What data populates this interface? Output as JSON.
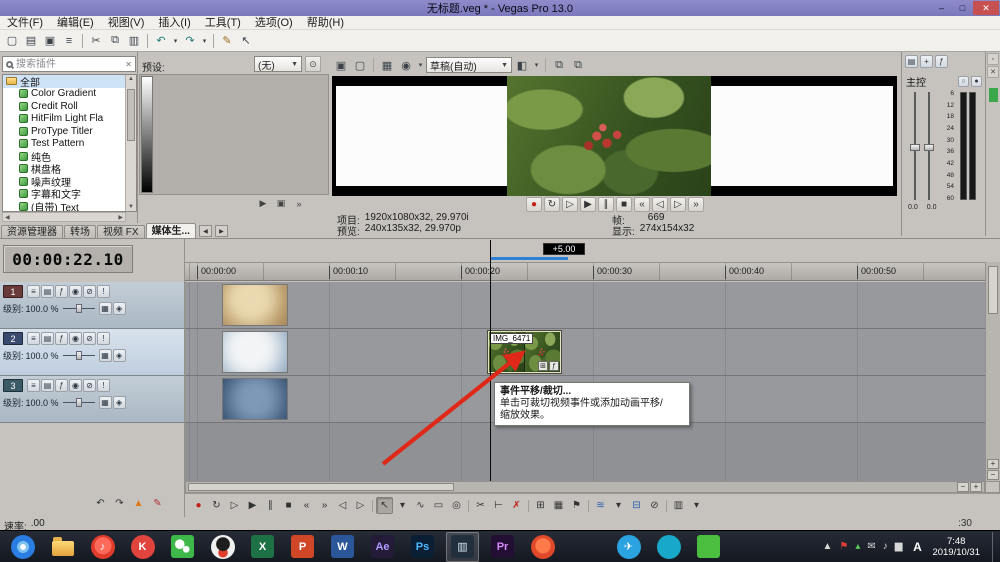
{
  "titlebar": {
    "title": "无标题.veg * - Vegas Pro 13.0",
    "buttons": [
      {
        "name": "minimize-button",
        "glyph": "–"
      },
      {
        "name": "maximize-button",
        "glyph": "□"
      },
      {
        "name": "close-button",
        "glyph": "✕",
        "cls": "close"
      }
    ]
  },
  "menubar": {
    "items": [
      {
        "label": "文件(F)"
      },
      {
        "label": "编辑(E)"
      },
      {
        "label": "视图(V)"
      },
      {
        "label": "插入(I)"
      },
      {
        "label": "工具(T)"
      },
      {
        "label": "选项(O)"
      },
      {
        "label": "帮助(H)"
      }
    ]
  },
  "toolbar": {
    "buttons": [
      {
        "name": "new-project-icon",
        "glyph": "▢"
      },
      {
        "name": "open-project-icon",
        "glyph": "▤"
      },
      {
        "name": "save-project-icon",
        "glyph": "▣"
      },
      {
        "name": "project-properties-icon",
        "glyph": "≡"
      },
      {
        "name": "separator",
        "glyph": "",
        "cls": "sep",
        "inter": "false"
      },
      {
        "name": "cut-icon",
        "glyph": "✂"
      },
      {
        "name": "copy-icon",
        "glyph": "⧉"
      },
      {
        "name": "paste-icon",
        "glyph": "▥"
      },
      {
        "name": "separator",
        "glyph": "",
        "cls": "sep",
        "inter": "false"
      },
      {
        "name": "undo-icon",
        "glyph": "↶",
        "color": "#1f7a7a"
      },
      {
        "name": "undo-caret-icon",
        "glyph": "▾",
        "cls": "caret"
      },
      {
        "name": "redo-icon",
        "glyph": "↷",
        "color": "#1f7a7a"
      },
      {
        "name": "redo-caret-icon",
        "glyph": "▾",
        "cls": "caret"
      },
      {
        "name": "separator",
        "glyph": "",
        "cls": "sep",
        "inter": "false"
      },
      {
        "name": "interactive-tutorials-icon",
        "glyph": "✎",
        "color": "#9a6a20"
      },
      {
        "name": "whats-this-help-icon",
        "glyph": "↖"
      }
    ]
  },
  "generators": {
    "search_placeholder": "搜索插件",
    "items": [
      {
        "label": "全部",
        "icon": "folder",
        "cls": "selected root"
      },
      {
        "label": "Color Gradient",
        "icon": "plugin"
      },
      {
        "label": "Credit Roll",
        "icon": "plugin"
      },
      {
        "label": "HitFilm Light Fla",
        "icon": "plugin"
      },
      {
        "label": "ProType Titler",
        "icon": "plugin"
      },
      {
        "label": "Test Pattern",
        "icon": "plugin"
      },
      {
        "label": "纯色",
        "icon": "plugin"
      },
      {
        "label": "棋盘格",
        "icon": "plugin"
      },
      {
        "label": "噪声纹理",
        "icon": "plugin"
      },
      {
        "label": "字幕和文字",
        "icon": "plugin"
      },
      {
        "label": "(自带) Text",
        "icon": "plugin"
      }
    ],
    "tabs": [
      {
        "label": "资源管理器"
      },
      {
        "label": "转场"
      },
      {
        "label": "视频 FX"
      },
      {
        "label": "媒体生...",
        "cls": "active"
      }
    ]
  },
  "presets": {
    "label": "预设:",
    "dropdown_value": "(无)",
    "buttons": [
      {
        "name": "play-preset-icon",
        "glyph": "▶"
      },
      {
        "name": "stop-preset-icon",
        "glyph": "▣"
      },
      {
        "name": "more-presets-icon",
        "glyph": "»"
      }
    ]
  },
  "preview": {
    "toolbar_left": [
      {
        "name": "project-video-properties-icon",
        "glyph": "▣"
      },
      {
        "name": "external-monitor-icon",
        "glyph": "▢"
      },
      {
        "name": "separator",
        "glyph": "",
        "cls": "sep",
        "inter": "false"
      },
      {
        "name": "video-output-fx-icon",
        "glyph": "▦"
      },
      {
        "name": "overlay-icon",
        "glyph": "◉"
      },
      {
        "name": "overlay-caret-icon",
        "glyph": "▾",
        "cls": "caret"
      }
    ],
    "quality_value": "草稿(自动)",
    "toolbar_right": [
      {
        "name": "split-screen-view-icon",
        "glyph": "◧"
      },
      {
        "name": "split-screen-caret-icon",
        "glyph": "▾",
        "cls": "caret"
      },
      {
        "name": "separator",
        "glyph": "",
        "cls": "sep",
        "inter": "false"
      },
      {
        "name": "grab-snapshot-icon",
        "glyph": "⧉"
      },
      {
        "name": "copy-snapshot-icon",
        "glyph": "⧉"
      }
    ],
    "transport": [
      {
        "name": "record-icon",
        "glyph": "●",
        "color": "#c22018"
      },
      {
        "name": "loop-playback-icon",
        "glyph": "↻"
      },
      {
        "name": "play-from-start-icon",
        "glyph": "▷"
      },
      {
        "name": "play-icon",
        "glyph": "▶"
      },
      {
        "name": "pause-icon",
        "glyph": "∥"
      },
      {
        "name": "stop-icon",
        "glyph": "■"
      },
      {
        "name": "go-to-start-icon",
        "glyph": "«"
      },
      {
        "name": "previous-frame-icon",
        "glyph": "◁"
      },
      {
        "name": "next-frame-icon",
        "glyph": "▷"
      },
      {
        "name": "go-to-end-icon",
        "glyph": "»"
      }
    ],
    "info": {
      "project_label": "项目:",
      "project_value": "1920x1080x32, 29.970i",
      "frame_label": "帧:",
      "frame_value": "669",
      "preview_label": "预览:",
      "preview_value": "240x135x32, 29.970p",
      "display_label": "显示:",
      "display_value": "274x154x32"
    }
  },
  "mixer": {
    "title": "主控",
    "toolbar": [
      {
        "name": "mixer-properties-icon",
        "glyph": "▤"
      },
      {
        "name": "insert-bus-icon",
        "glyph": "+"
      },
      {
        "name": "insert-fx-icon",
        "glyph": "ƒ"
      }
    ],
    "header_icons": [
      {
        "name": "master-mute-icon",
        "glyph": "○"
      },
      {
        "name": "master-solo-icon",
        "glyph": "●"
      }
    ],
    "scale": [
      "6",
      "12",
      "18",
      "24",
      "30",
      "36",
      "42",
      "48",
      "54",
      "60"
    ],
    "fader_values": [
      "0.0",
      "0.0"
    ]
  },
  "right_strip": {
    "icons": [
      {
        "name": "auto-hide-panel-icon",
        "glyph": "▫"
      },
      {
        "name": "close-panel-icon",
        "glyph": "✕"
      }
    ]
  },
  "timeline": {
    "timecode": "00:00:22.10",
    "offset_badge": "+5.00",
    "ruler": [
      {
        "label": "00:00:00"
      },
      {
        "label": "00:00:10"
      },
      {
        "label": "00:00:20"
      },
      {
        "label": "00:00:30"
      },
      {
        "label": "00:00:40"
      },
      {
        "label": "00:00:50"
      }
    ],
    "tracks": [
      {
        "number": "1",
        "color": "#6a3a3a",
        "level_label": "级别:",
        "level_value": "100.0 %"
      },
      {
        "number": "2",
        "color": "#3a4a6e",
        "level_label": "级别:",
        "level_value": "100.0 %"
      },
      {
        "number": "3",
        "color": "#3a5a66",
        "level_label": "级别:",
        "level_value": "100.0 %"
      }
    ],
    "track_icons": [
      {
        "name": "track-motion-icon",
        "glyph": "≡"
      },
      {
        "name": "bypass-fx-icon",
        "glyph": "▤"
      },
      {
        "name": "track-fx-icon",
        "glyph": "ƒ"
      },
      {
        "name": "automation-settings-icon",
        "glyph": "◉"
      },
      {
        "name": "mute-icon",
        "glyph": "⊘"
      },
      {
        "name": "solo-icon",
        "glyph": "!"
      }
    ],
    "level_icons": [
      {
        "name": "compositing-mode-icon",
        "glyph": "▦"
      },
      {
        "name": "make-child-icon",
        "glyph": "◈"
      }
    ],
    "clip": {
      "label": "IMG_6471",
      "icons": [
        {
          "name": "pan-crop-icon",
          "glyph": "⊞"
        },
        {
          "name": "event-fx-icon",
          "glyph": "ƒ"
        }
      ]
    },
    "left_tools": [
      {
        "name": "undo-small-icon",
        "glyph": "↶"
      },
      {
        "name": "redo-small-icon",
        "glyph": "↷"
      },
      {
        "name": "warning-icon",
        "glyph": "▲",
        "color": "#e07818"
      },
      {
        "name": "edit-pen-icon",
        "glyph": "✎",
        "color": "#b03030"
      }
    ],
    "transport": [
      {
        "name": "record-icon",
        "glyph": "●",
        "color": "#c22018"
      },
      {
        "name": "loop-playback-icon",
        "glyph": "↻"
      },
      {
        "name": "play-from-start-icon",
        "glyph": "▷"
      },
      {
        "name": "play-icon",
        "glyph": "▶"
      },
      {
        "name": "pause-icon",
        "glyph": "∥"
      },
      {
        "name": "stop-icon",
        "glyph": "■"
      },
      {
        "name": "go-to-start-icon",
        "glyph": "«"
      },
      {
        "name": "go-to-end-icon",
        "glyph": "»"
      },
      {
        "name": "previous-frame-icon",
        "glyph": "◁"
      },
      {
        "name": "next-frame-icon",
        "glyph": "▷"
      },
      {
        "name": "separator",
        "glyph": "",
        "cls": "sep",
        "inter": "false"
      },
      {
        "name": "normal-edit-tool-icon",
        "glyph": "↖",
        "cls": "active"
      },
      {
        "name": "edit-tool-caret-icon",
        "glyph": "▾",
        "cls": "caret"
      },
      {
        "name": "envelope-edit-tool-icon",
        "glyph": "∿"
      },
      {
        "name": "selection-edit-tool-icon",
        "glyph": "▭"
      },
      {
        "name": "zoom-edit-tool-icon",
        "glyph": "◎"
      },
      {
        "name": "separator",
        "glyph": "",
        "cls": "sep",
        "inter": "false"
      },
      {
        "name": "split-event-icon",
        "glyph": "✂"
      },
      {
        "name": "trim-event-icon",
        "glyph": "⊢"
      },
      {
        "name": "delete-event-icon",
        "glyph": "✗",
        "color": "#c22018"
      },
      {
        "name": "separator",
        "glyph": "",
        "cls": "sep",
        "inter": "false"
      },
      {
        "name": "enable-snapping-icon",
        "glyph": "⊞"
      },
      {
        "name": "snap-to-grid-icon",
        "glyph": "▦"
      },
      {
        "name": "snap-to-markers-icon",
        "glyph": "⚑"
      },
      {
        "name": "separator",
        "glyph": "",
        "cls": "sep",
        "inter": "false"
      },
      {
        "name": "auto-ripple-icon",
        "glyph": "≋",
        "color": "#2a5fae"
      },
      {
        "name": "auto-ripple-caret-icon",
        "glyph": "▾",
        "cls": "caret"
      },
      {
        "name": "lock-envelopes-icon",
        "glyph": "⊟",
        "color": "#2a5fae"
      },
      {
        "name": "ignore-event-grouping-icon",
        "glyph": "⊘"
      },
      {
        "name": "separator",
        "glyph": "",
        "cls": "sep",
        "inter": "false"
      },
      {
        "name": "event-tools-icon",
        "glyph": "▥"
      },
      {
        "name": "tools-caret-icon",
        "glyph": "▾",
        "cls": "caret"
      }
    ],
    "rate_label": "速率:",
    "rate_value": ".00",
    "end_time": ":30"
  },
  "tooltip": {
    "title": "事件平移/裁切...",
    "line1": "单击可裁切视频事件或添加动画平移/",
    "line2": "缩放效果。"
  },
  "taskbar": {
    "icons": [
      {
        "name": "browser-icon",
        "shape": "circle",
        "bg": "radial-gradient(circle at 50% 50%, #ffffff 16%, #7ec3f0 18% 34%, #2a7de1 36% 70%, #1a5fb8 72%)",
        "glyph": "",
        "fg": ""
      },
      {
        "name": "file-explorer-icon",
        "shape": "folder",
        "bg": "",
        "glyph": "",
        "fg": ""
      },
      {
        "name": "music-app-icon",
        "shape": "circle",
        "bg": "radial-gradient(circle at 50% 45%, #ff6a5a 0 45%, #e03c2c 50%)",
        "glyph": "♪",
        "fg": "#ffffff"
      },
      {
        "name": "kugou-music-icon",
        "shape": "circle",
        "bg": "#e0443c",
        "glyph": "K",
        "fg": "#ffffff"
      },
      {
        "name": "wechat-icon",
        "shape": "square",
        "bg": "radial-gradient(circle at 38% 40%, #ffffff 22%, rgba(255,255,255,0) 26%), radial-gradient(circle at 66% 62%, #ffffff 14%, rgba(255,255,255,0) 18%), #3eb849",
        "glyph": "",
        "fg": ""
      },
      {
        "name": "qq-icon",
        "shape": "circle",
        "bg": "radial-gradient(circle at 50% 38%, #1d1d1d 34%, rgba(0,0,0,0) 38%), radial-gradient(circle at 50% 74%, #e03c2c 20%, rgba(0,0,0,0) 24%), #f0f0f0",
        "glyph": "",
        "fg": ""
      },
      {
        "name": "excel-icon",
        "shape": "square",
        "bg": "#1e7145",
        "glyph": "X",
        "fg": "#ffffff"
      },
      {
        "name": "powerpoint-icon",
        "shape": "square",
        "bg": "#d04727",
        "glyph": "P",
        "fg": "#ffffff"
      },
      {
        "name": "word-icon",
        "shape": "square",
        "bg": "#2b579a",
        "glyph": "W",
        "fg": "#ffffff"
      },
      {
        "name": "after-effects-icon",
        "shape": "square",
        "bg": "#241b38",
        "glyph": "Ae",
        "fg": "#b09aff"
      },
      {
        "name": "photoshop-icon",
        "shape": "square",
        "bg": "#0a1f33",
        "glyph": "Ps",
        "fg": "#4db8ff"
      },
      {
        "name": "vegas-pro-icon",
        "shape": "square",
        "bg": "#22303e",
        "glyph": "▥",
        "fg": "#d8e8f4",
        "cls": "active"
      },
      {
        "name": "premiere-icon",
        "shape": "square",
        "bg": "#230f33",
        "glyph": "Pr",
        "fg": "#d88bff"
      },
      {
        "name": "red-app-icon",
        "shape": "circle",
        "bg": "radial-gradient(circle at 50% 45%, #ff7a4a 0 40%, #e0482a 46%)",
        "glyph": "",
        "fg": ""
      },
      {
        "name": "paper-plane-app-icon",
        "shape": "circle",
        "bg": "#2ba3e0",
        "glyph": "✈",
        "fg": "#ffffff",
        "cls": "gap-left"
      },
      {
        "name": "teal-app-icon",
        "shape": "circle",
        "bg": "#18a8c8",
        "glyph": "",
        "fg": ""
      },
      {
        "name": "green-app-icon",
        "shape": "square",
        "bg": "#4cbe3f",
        "glyph": "",
        "fg": ""
      }
    ],
    "tray": [
      {
        "name": "tray-chevron-icon",
        "glyph": "▲",
        "color": "#d8d8d8"
      },
      {
        "name": "tray-flag-icon",
        "glyph": "⚑",
        "color": "#e04038"
      },
      {
        "name": "tray-chart-icon",
        "glyph": "▴",
        "color": "#58c858"
      },
      {
        "name": "tray-mail-icon",
        "glyph": "✉",
        "color": "#d8d8d8"
      },
      {
        "name": "tray-volume-icon",
        "glyph": "♪",
        "color": "#d8d8d8"
      },
      {
        "name": "tray-network-icon",
        "glyph": "▆",
        "color": "#d8d8d8"
      }
    ],
    "ime": "A",
    "time": "7:48",
    "date": "2019/10/31"
  }
}
